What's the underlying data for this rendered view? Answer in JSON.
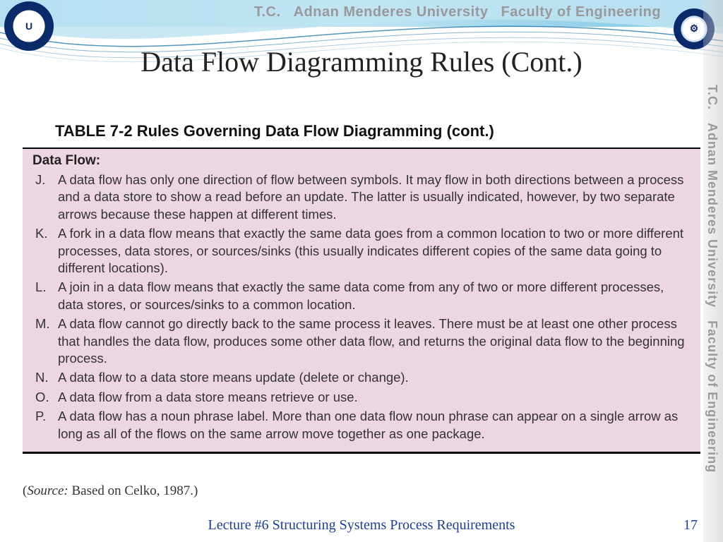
{
  "banner": {
    "tc": "T.C.",
    "university": "Adnan Menderes University",
    "faculty": "Faculty of Engineering"
  },
  "title": "Data Flow Diagramming Rules (Cont.)",
  "table": {
    "caption": "TABLE 7-2 Rules Governing Data Flow Diagramming (cont.)",
    "section": "Data Flow:",
    "rules": {
      "J": "A data flow has only one direction of flow between symbols. It may flow in both directions between a process and a data store to show a read before an update. The latter is usually indicated, however, by two separate arrows because these happen at different times.",
      "K": "A fork in a data flow means that exactly the same data goes from a common location to two or more different processes, data stores, or sources/sinks (this usually indicates different copies of the same data going to different locations).",
      "L": "A join in a data flow means that exactly the same data come from any of two or more different processes, data stores, or sources/sinks to a common location.",
      "M": "A data flow cannot go directly back to the same process it leaves. There must be at least one other process that handles the data flow, produces some other data flow, and returns the original data flow to the beginning process.",
      "N": "A data flow to a data store means update (delete or change).",
      "O": "A data flow from a data store means retrieve or use.",
      "P": "A data flow has a noun phrase label. More than one data flow noun phrase can appear on a single arrow as long as all of the flows on the same arrow move together as one package."
    },
    "letters": {
      "J": "J.",
      "K": "K.",
      "L": "L.",
      "M": "M.",
      "N": "N.",
      "O": "O.",
      "P": "P."
    }
  },
  "source": {
    "label": "Source:",
    "text": " Based on Celko, 1987.)"
  },
  "footer": "Lecture #6 Structuring Systems Process Requirements",
  "page": "17",
  "sidestrip": {
    "tc": "T.C.",
    "university": "Adnan Menderes University",
    "faculty": "Faculty of Engineering"
  },
  "logos": {
    "left_inner": "U",
    "right_inner": "⚙"
  }
}
